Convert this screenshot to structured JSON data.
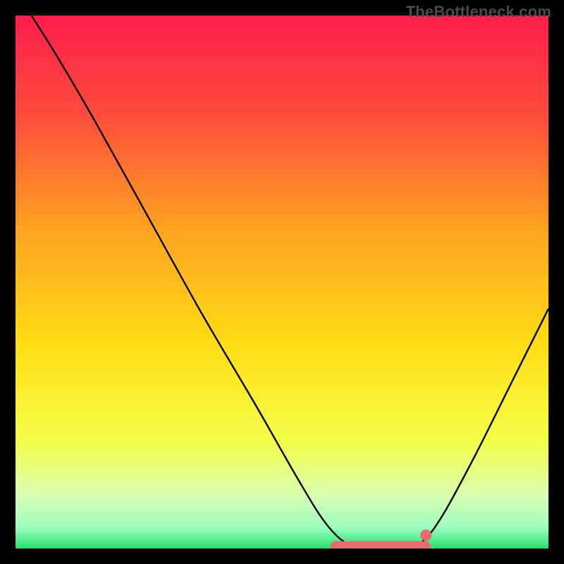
{
  "watermark": "TheBottleneck.com",
  "chart_data": {
    "type": "line",
    "title": "",
    "xlabel": "",
    "ylabel": "",
    "xlim": [
      0,
      100
    ],
    "ylim": [
      0,
      100
    ],
    "gradient_stops": [
      {
        "offset": 0,
        "color": "#ff1e4a"
      },
      {
        "offset": 0.18,
        "color": "#ff4a3d"
      },
      {
        "offset": 0.4,
        "color": "#ffa21f"
      },
      {
        "offset": 0.62,
        "color": "#ffde14"
      },
      {
        "offset": 0.8,
        "color": "#f3ff4a"
      },
      {
        "offset": 0.9,
        "color": "#d8ffb0"
      },
      {
        "offset": 0.96,
        "color": "#9dffc0"
      },
      {
        "offset": 1.0,
        "color": "#25e06a"
      }
    ],
    "series": [
      {
        "name": "bottleneck-curve",
        "color": "#000000",
        "points": [
          {
            "x": 3,
            "y": 100
          },
          {
            "x": 8,
            "y": 92
          },
          {
            "x": 15,
            "y": 80
          },
          {
            "x": 25,
            "y": 62
          },
          {
            "x": 35,
            "y": 44
          },
          {
            "x": 45,
            "y": 27
          },
          {
            "x": 53,
            "y": 13
          },
          {
            "x": 58,
            "y": 5
          },
          {
            "x": 62,
            "y": 1
          },
          {
            "x": 66,
            "y": 0
          },
          {
            "x": 72,
            "y": 0
          },
          {
            "x": 76,
            "y": 1
          },
          {
            "x": 80,
            "y": 6
          },
          {
            "x": 86,
            "y": 17
          },
          {
            "x": 93,
            "y": 31
          },
          {
            "x": 100,
            "y": 45
          }
        ]
      }
    ],
    "highlight_band": {
      "color": "#e86a6a",
      "x_start": 60,
      "x_end": 77,
      "y": 0.5
    },
    "marker": {
      "color": "#e86a6a",
      "x": 77,
      "y": 2.5
    }
  }
}
